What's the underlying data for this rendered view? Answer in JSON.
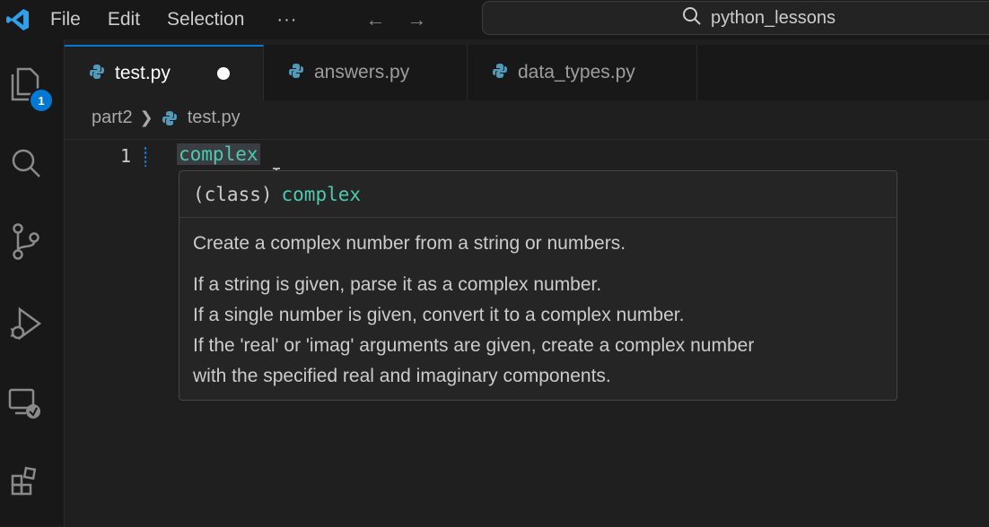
{
  "menu": {
    "file": "File",
    "edit": "Edit",
    "selection": "Selection",
    "more": "···"
  },
  "search": {
    "text": "python_lessons"
  },
  "activity": {
    "explorer_badge": "1"
  },
  "tabs": [
    {
      "label": "test.py",
      "active": true,
      "dirty": true
    },
    {
      "label": "answers.py",
      "active": false
    },
    {
      "label": "data_types.py",
      "active": false
    }
  ],
  "breadcrumb": {
    "folder": "part2",
    "file": "test.py"
  },
  "editor": {
    "line_number": "1",
    "code": "complex"
  },
  "hover": {
    "signature_prefix": "(class)",
    "signature_name": "complex",
    "doc_line1": "Create a complex number from a string or numbers.",
    "doc_line2": "If a string is given, parse it as a complex number.",
    "doc_line3": "If a single number is given, convert it to a complex number.",
    "doc_line4": "If the 'real' or 'imag' arguments are given, create a complex number",
    "doc_line5": "with the specified real and imaginary components."
  },
  "colors": {
    "accent": "#0078d4",
    "class_name": "#4ec9b0",
    "editor_bg": "#1f1f1f",
    "python_icon": "#519aba"
  }
}
